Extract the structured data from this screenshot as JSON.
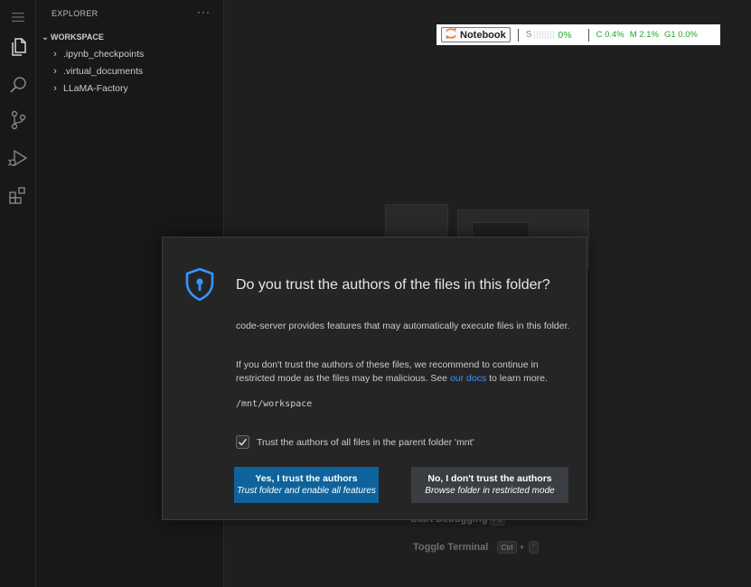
{
  "explorer": {
    "header": "EXPLORER",
    "more": "···",
    "workspace_label": "WORKSPACE",
    "items": [
      {
        "label": ".ipynb_checkpoints"
      },
      {
        "label": ".virtual_documents"
      },
      {
        "label": "LLaMA-Factory"
      }
    ]
  },
  "activity_bar": {
    "icons": [
      "menu-icon",
      "files-icon",
      "search-icon",
      "source-control-icon",
      "run-debug-icon",
      "extensions-icon"
    ]
  },
  "status_widget": {
    "notebook_label": "Notebook",
    "s_label": "S",
    "s_value": "0%",
    "c_metric": "C 0.4%",
    "m_metric": "M 2.1%",
    "g_metric": "G1 0.0%"
  },
  "watermark": {
    "start_debugging": "Start Debugging",
    "start_debugging_key": "F5",
    "toggle_terminal": "Toggle Terminal",
    "toggle_terminal_key1": "Ctrl",
    "toggle_terminal_plus": "+",
    "toggle_terminal_key2": "`"
  },
  "dialog": {
    "title": "Do you trust the authors of the files in this folder?",
    "paragraph1": "code-server provides features that may automatically execute files in this folder.",
    "paragraph2_pre": "If you don't trust the authors of these files, we recommend to continue in restricted mode as the files may be malicious. See ",
    "paragraph2_link": "our docs",
    "paragraph2_post": " to learn more.",
    "path": "/mnt/workspace",
    "checkbox_label": "Trust the authors of all files in the parent folder 'mnt'",
    "checkbox_checked": true,
    "yes_button": {
      "line1": "Yes, I trust the authors",
      "line2": "Trust folder and enable all features"
    },
    "no_button": {
      "line1": "No, I don't trust the authors",
      "line2": "Browse folder in restricted mode"
    }
  },
  "colors": {
    "accent_blue": "#0e639c",
    "link_blue": "#3794ff",
    "metric_green": "#26a626",
    "notebook_orange": "#f37626"
  }
}
